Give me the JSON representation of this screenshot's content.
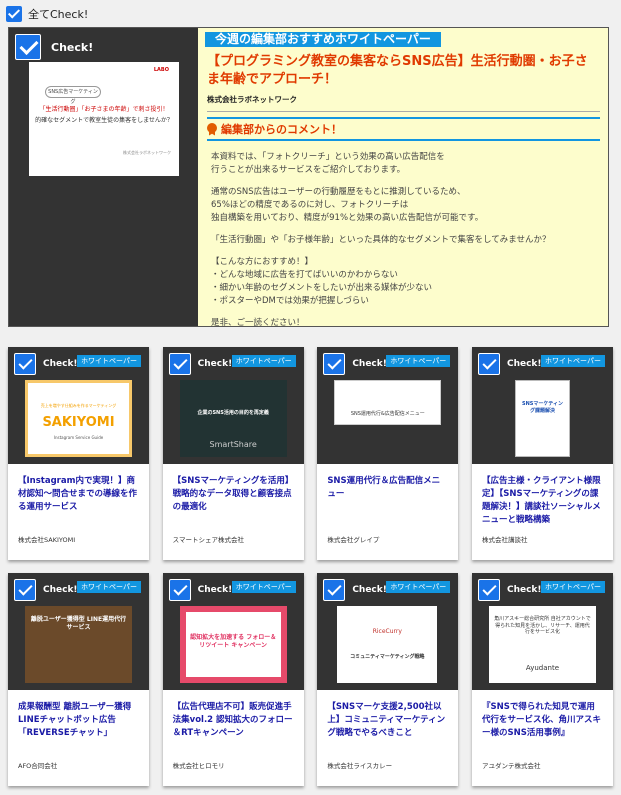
{
  "check_all_label": "全てCheck!",
  "featured": {
    "check_label": "Check!",
    "banner": "今週の編集部おすすめホワイトペーパー",
    "title": "【プログラミング教室の集客ならSNS広告】生活行動圏・お子さま年齢でアプローチ！",
    "company": "株式会社ラボネットワーク",
    "comment_heading": "編集部からのコメント！",
    "thumb": {
      "logo": "LABO",
      "badge": "SNS広告マーケティング",
      "line1": "「生活行動圏」「お子さまの年齢」で刺さ投引！",
      "line2": "的確なセグメントで教室生徒の集客をしませんか？",
      "footer": "株式会社ラボネットワーク"
    },
    "body": [
      [
        "本資料では、「フォトクリーチ」という効果の高い広告配信を",
        "行うことが出来るサービスをご紹介しております。"
      ],
      [
        "通常のSNS広告はユーザーの行動履歴をもとに推測しているため、",
        "65%ほどの精度であるのに対し、フォトクリーチは",
        "独自構築を用いており、精度が91%と効果の高い広告配信が可能です。"
      ],
      [
        "「生活行動圏」や「お子様年齢」といった具体的なセグメントで集客をしてみませんか？"
      ],
      [
        "【こんな方におすすめ！】",
        "・どんな地域に広告を打てばいいのかわからない",
        "・細かい年齢のセグメントをしたいが出来る媒体が少ない",
        "・ポスターやDMでは効果が把握しづらい"
      ],
      [
        "是非、ご一読ください！"
      ]
    ]
  },
  "card_check_label": "Check!",
  "card_tag": "ホワイトペーパー",
  "cards": [
    {
      "title": "【Instagram内で実現！】商材認知〜問合せまでの導線を作る運用サービス",
      "company": "株式会社SAKIYOMI",
      "thumb_main": "SAKIYOMI",
      "thumb_sub": "Instagram Service Guide",
      "thumb_top": "売上を増やす仕組みを作るマーケティング"
    },
    {
      "title": "【SNSマーケティングを活用】戦略的なデータ取得と顧客接点の最適化",
      "company": "スマートシェア株式会社",
      "thumb_main": "企業のSNS活用の目的を再定義",
      "thumb_sub": "SmartShare",
      "thumb_top": ""
    },
    {
      "title": "SNS運用代行＆広告配信メニュー",
      "company": "株式会社グレイプ",
      "thumb_main": "SNS運用代行&広告配信メニュー",
      "thumb_sub": "",
      "thumb_top": ""
    },
    {
      "title": "【広告主様・クライアント様限定】【SNSマーケティングの課題解決！】講談社ソーシャルメニューと戦略構築",
      "company": "株式会社講談社",
      "thumb_main": "SNSマーケティング課題解決",
      "thumb_sub": "",
      "thumb_top": ""
    },
    {
      "title": "成果報酬型 離脱ユーザー獲得LINEチャットボット広告「REVERSEチャット」",
      "company": "AFO合同会社",
      "thumb_main": "離脱ユーザー獲得型 LINE運用代行サービス",
      "thumb_sub": "",
      "thumb_top": ""
    },
    {
      "title": "【広告代理店不可】販売促進手法集vol.2 認知拡大のフォロー＆RTキャンペーン",
      "company": "株式会社ヒロモリ",
      "thumb_main": "認知拡大を加速する フォロー＆リツイート キャンペーン",
      "thumb_sub": "",
      "thumb_top": ""
    },
    {
      "title": "【SNSマーケ支援2,500社以上】コミュニティマーケティング戦略でやるべきこと",
      "company": "株式会社ライスカレー",
      "thumb_main": "コミュニティマーケティング戦略",
      "thumb_sub": "RiceCurry",
      "thumb_top": ""
    },
    {
      "title": "『SNSで得られた知見で運用代行をサービス化、角川アスキー様のSNS活用事例』",
      "company": "アユダンテ株式会社",
      "thumb_main": "角川アスキー総合研究所 自社アカウントで得られた知見を活かし、リサーチ、運用代行をサービス化",
      "thumb_sub": "Ayudante",
      "thumb_top": ""
    }
  ]
}
